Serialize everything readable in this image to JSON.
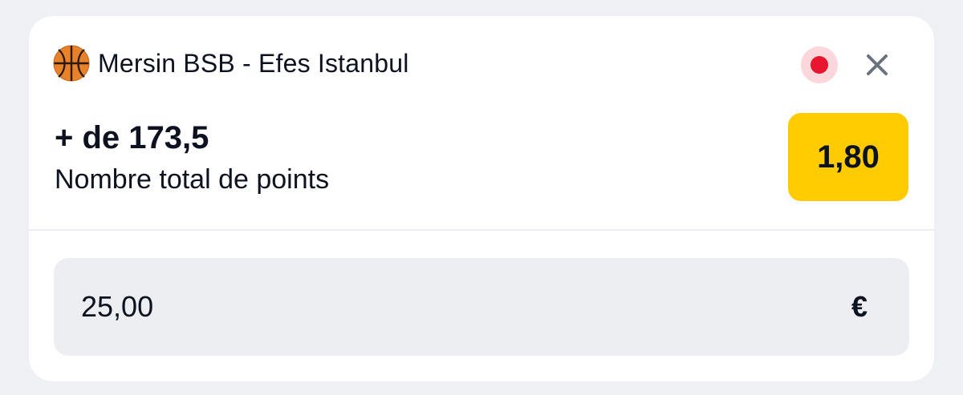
{
  "match": {
    "title": "Mersin BSB - Efes Istanbul",
    "sport_icon": "basketball-icon",
    "live_indicator_color": "#e8152f"
  },
  "bet": {
    "selection": "+ de 173,5",
    "market": "Nombre total de points",
    "odds": "1,80",
    "odds_color": "#fdcb00"
  },
  "stake": {
    "value": "25,00",
    "currency": "€"
  },
  "icons": {
    "close": "close-icon",
    "live": "live-dot-icon"
  }
}
